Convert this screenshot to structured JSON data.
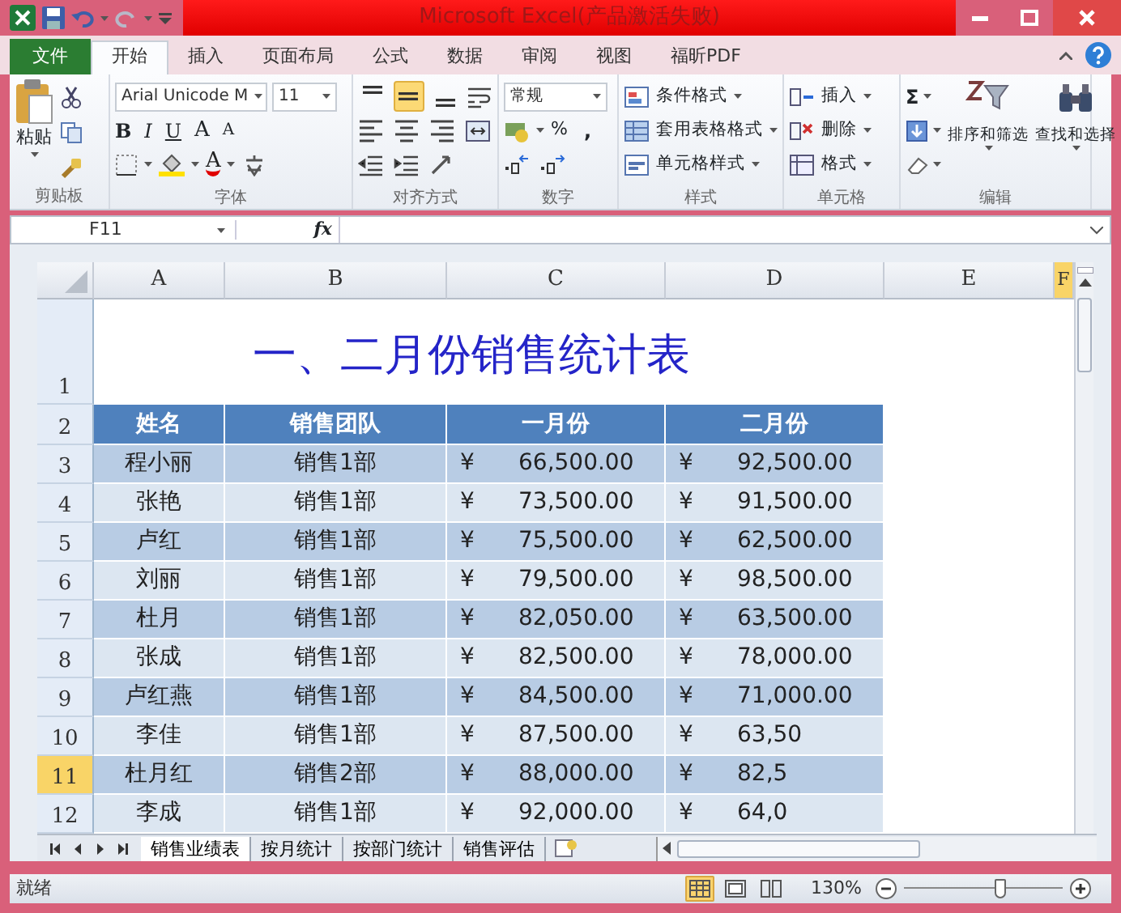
{
  "window": {
    "title": "Microsoft Excel(产品激活失败)"
  },
  "ribbon_tabs": [
    {
      "label": "文件",
      "kind": "file",
      "selected": false
    },
    {
      "label": "开始",
      "kind": "tab",
      "selected": true
    },
    {
      "label": "插入",
      "kind": "tab",
      "selected": false
    },
    {
      "label": "页面布局",
      "kind": "tab",
      "selected": false
    },
    {
      "label": "公式",
      "kind": "tab",
      "selected": false
    },
    {
      "label": "数据",
      "kind": "tab",
      "selected": false
    },
    {
      "label": "审阅",
      "kind": "tab",
      "selected": false
    },
    {
      "label": "视图",
      "kind": "tab",
      "selected": false
    },
    {
      "label": "福昕PDF",
      "kind": "tab",
      "selected": false
    }
  ],
  "clipboard": {
    "paste": "粘贴",
    "group_label": "剪贴板"
  },
  "font": {
    "font_name": "Arial Unicode M",
    "font_size": "11",
    "bold": "B",
    "italic": "I",
    "underline": "U",
    "grow": "A",
    "shrink": "A",
    "font_color": "A",
    "group_label": "字体"
  },
  "alignment": {
    "vertical": [
      {
        "selected": false
      },
      {
        "selected": true
      },
      {
        "selected": false
      }
    ],
    "group_label": "对齐方式"
  },
  "number": {
    "format": "常规",
    "percent": "%",
    "comma": ",",
    "group_label": "数字"
  },
  "styles": {
    "items": [
      "条件格式",
      "套用表格格式",
      "单元格样式"
    ],
    "group_label": "样式"
  },
  "cells": {
    "items": [
      "插入",
      "删除",
      "格式"
    ],
    "group_label": "单元格"
  },
  "editing": {
    "sum": "Σ",
    "items": [
      "排序和筛选",
      "查找和选择"
    ],
    "group_label": "编辑"
  },
  "formula_bar": {
    "name_box": "F11",
    "function_label": "fx"
  },
  "sheet": {
    "columns": [
      {
        "label": "A",
        "selected": false
      },
      {
        "label": "B",
        "selected": false
      },
      {
        "label": "C",
        "selected": false
      },
      {
        "label": "D",
        "selected": false
      },
      {
        "label": "E",
        "selected": false
      },
      {
        "label": "F",
        "selected": true
      }
    ],
    "title_row": {
      "number": "1",
      "selected": false,
      "title": "一、二月份销售统计表"
    },
    "header_row": {
      "number": "2",
      "selected": false,
      "headers": [
        "姓名",
        "销售团队",
        "一月份",
        "二月份"
      ]
    },
    "rows": [
      {
        "number": "3",
        "selected": false,
        "cells": [
          "程小丽",
          "销售1部",
          {
            "symbol": "¥",
            "amount": "66,500.00"
          },
          {
            "symbol": "¥",
            "amount": "92,500.00"
          }
        ]
      },
      {
        "number": "4",
        "selected": false,
        "cells": [
          "张艳",
          "销售1部",
          {
            "symbol": "¥",
            "amount": "73,500.00"
          },
          {
            "symbol": "¥",
            "amount": "91,500.00"
          }
        ]
      },
      {
        "number": "5",
        "selected": false,
        "cells": [
          "卢红",
          "销售1部",
          {
            "symbol": "¥",
            "amount": "75,500.00"
          },
          {
            "symbol": "¥",
            "amount": "62,500.00"
          }
        ]
      },
      {
        "number": "6",
        "selected": false,
        "cells": [
          "刘丽",
          "销售1部",
          {
            "symbol": "¥",
            "amount": "79,500.00"
          },
          {
            "symbol": "¥",
            "amount": "98,500.00"
          }
        ]
      },
      {
        "number": "7",
        "selected": false,
        "cells": [
          "杜月",
          "销售1部",
          {
            "symbol": "¥",
            "amount": "82,050.00"
          },
          {
            "symbol": "¥",
            "amount": "63,500.00"
          }
        ]
      },
      {
        "number": "8",
        "selected": false,
        "cells": [
          "张成",
          "销售1部",
          {
            "symbol": "¥",
            "amount": "82,500.00"
          },
          {
            "symbol": "¥",
            "amount": "78,000.00"
          }
        ]
      },
      {
        "number": "9",
        "selected": false,
        "cells": [
          "卢红燕",
          "销售1部",
          {
            "symbol": "¥",
            "amount": "84,500.00"
          },
          {
            "symbol": "¥",
            "amount": "71,000.00"
          }
        ]
      },
      {
        "number": "10",
        "selected": false,
        "cells": [
          "李佳",
          "销售1部",
          {
            "symbol": "¥",
            "amount": "87,500.00"
          },
          {
            "symbol": "¥",
            "amount": "63,50"
          }
        ]
      },
      {
        "number": "11",
        "selected": true,
        "cells": [
          "杜月红",
          "销售2部",
          {
            "symbol": "¥",
            "amount": "88,000.00"
          },
          {
            "symbol": "¥",
            "amount": "82,5"
          }
        ]
      },
      {
        "number": "12",
        "selected": false,
        "cells": [
          "李成",
          "销售1部",
          {
            "symbol": "¥",
            "amount": "92,000.00"
          },
          {
            "symbol": "¥",
            "amount": "64,0"
          }
        ]
      }
    ]
  },
  "sheet_tabs": [
    {
      "label": "销售业绩表",
      "selected": true
    },
    {
      "label": "按月统计",
      "selected": false
    },
    {
      "label": "按部门统计",
      "selected": false
    },
    {
      "label": "销售评估",
      "selected": false
    }
  ],
  "status_bar": {
    "status": "就绪",
    "view_buttons": [
      {
        "selected": true
      },
      {
        "selected": false
      },
      {
        "selected": false
      }
    ],
    "zoom": "130%",
    "level": 0.6
  }
}
